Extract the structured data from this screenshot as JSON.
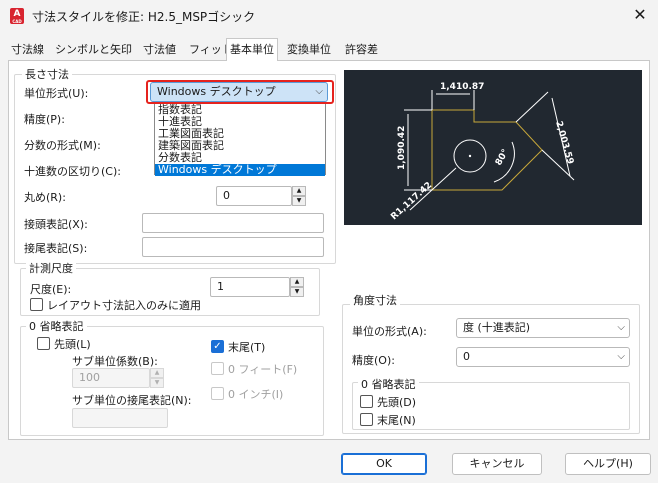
{
  "window": {
    "title": "寸法スタイルを修正: H2.5_MSPゴシック",
    "app_icon_text": "A",
    "close_glyph": "✕"
  },
  "tabs": [
    {
      "label": "寸法線",
      "active": false
    },
    {
      "label": "シンボルと矢印",
      "active": false
    },
    {
      "label": "寸法値",
      "active": false
    },
    {
      "label": "フィット",
      "active": false
    },
    {
      "label": "基本単位",
      "active": true
    },
    {
      "label": "変換単位",
      "active": false
    },
    {
      "label": "許容差",
      "active": false
    }
  ],
  "linear": {
    "group_label": "長さ寸法",
    "unit_format_label": "単位形式(U):",
    "unit_format_value": "Windows デスクトップ",
    "precision_label": "精度(P):",
    "fraction_label": "分数の形式(M):",
    "decimal_sep_label": "十進数の区切り(C):",
    "round_label": "丸め(R):",
    "round_value": "0",
    "prefix_label": "接頭表記(X):",
    "prefix_value": "",
    "suffix_label": "接尾表記(S):",
    "suffix_value": ""
  },
  "dropdown": {
    "items": [
      {
        "label": "指数表記",
        "selected": false
      },
      {
        "label": "十進表記",
        "selected": false
      },
      {
        "label": "工業図面表記",
        "selected": false
      },
      {
        "label": "建築図面表記",
        "selected": false
      },
      {
        "label": "分数表記",
        "selected": false
      },
      {
        "label": "Windows デスクトップ",
        "selected": true
      }
    ]
  },
  "measurement": {
    "group_label": "計測尺度",
    "scale_label": "尺度(E):",
    "scale_value": "1",
    "layout_only_label": "レイアウト寸法記入のみに適用"
  },
  "zero_suppression": {
    "group_label": "0 省略表記",
    "leading_label": "先頭(L)",
    "trailing_label": "末尾(T)",
    "sub_unit_factor_label": "サブ単位係数(B):",
    "sub_unit_factor_value": "100",
    "zero_feet_label": "0 フィート(F)",
    "sub_unit_suffix_label": "サブ単位の接尾表記(N):",
    "zero_inch_label": "0 インチ(I)",
    "leading_checked": false,
    "trailing_checked": true
  },
  "angular": {
    "group_label": "角度寸法",
    "unit_format_label": "単位の形式(A):",
    "unit_format_value": "度 (十進表記)",
    "precision_label": "精度(O):",
    "precision_value": "0",
    "zero_group_label": "0 省略表記",
    "leading_label": "先頭(D)",
    "trailing_label": "末尾(N)"
  },
  "preview": {
    "dim_top": "1,410.87",
    "dim_left": "1,090.42",
    "dim_right": "2,003.59",
    "dim_angle": "80°",
    "dim_radius": "R1,117.42"
  },
  "buttons": {
    "ok": "OK",
    "cancel": "キャンセル",
    "help": "ヘルプ(H)"
  },
  "chevron": "⌵",
  "check_glyph": "✓"
}
